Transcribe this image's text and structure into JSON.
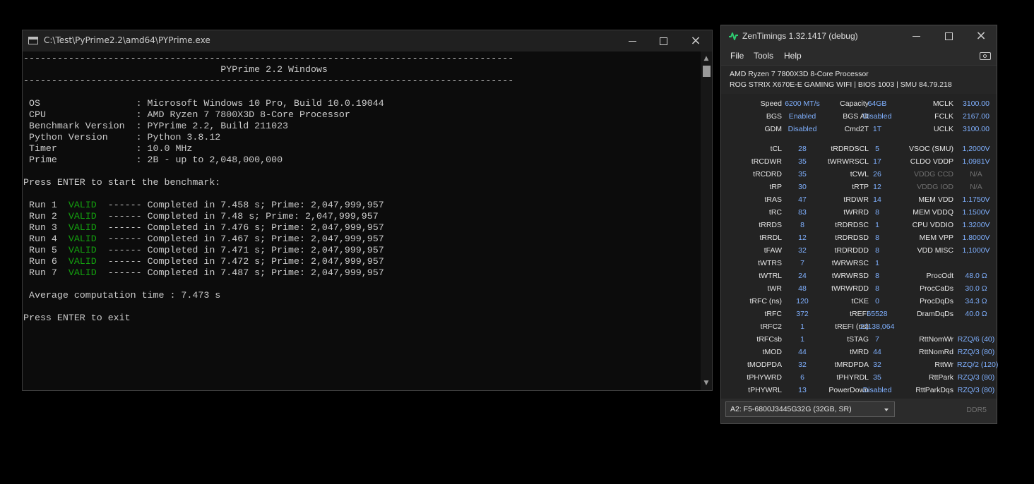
{
  "console": {
    "title": "C:\\Test\\PyPrime2.2\\amd64\\PYPrime.exe",
    "lines": [
      "---------------------------------------------------------------------------------------",
      "                                   PYPrime 2.2 Windows",
      "---------------------------------------------------------------------------------------",
      "",
      " OS                 : Microsoft Windows 10 Pro, Build 10.0.19044",
      " CPU                : AMD Ryzen 7 7800X3D 8-Core Processor",
      " Benchmark Version  : PYPrime 2.2, Build 211023",
      " Python Version     : Python 3.8.12",
      " Timer              : 10.0 MHz",
      " Prime              : 2B - up to 2,048,000,000",
      "",
      "Press ENTER to start the benchmark:",
      ""
    ],
    "runs": [
      {
        "label": " Run 1  ",
        "status": "VALID",
        "text": "  ------ Completed in 7.458 s; Prime: 2,047,999,957"
      },
      {
        "label": " Run 2  ",
        "status": "VALID",
        "text": "  ------ Completed in 7.48 s; Prime: 2,047,999,957"
      },
      {
        "label": " Run 3  ",
        "status": "VALID",
        "text": "  ------ Completed in 7.476 s; Prime: 2,047,999,957"
      },
      {
        "label": " Run 4  ",
        "status": "VALID",
        "text": "  ------ Completed in 7.467 s; Prime: 2,047,999,957"
      },
      {
        "label": " Run 5  ",
        "status": "VALID",
        "text": "  ------ Completed in 7.471 s; Prime: 2,047,999,957"
      },
      {
        "label": " Run 6  ",
        "status": "VALID",
        "text": "  ------ Completed in 7.472 s; Prime: 2,047,999,957"
      },
      {
        "label": " Run 7  ",
        "status": "VALID",
        "text": "  ------ Completed in 7.487 s; Prime: 2,047,999,957"
      }
    ],
    "tail_lines": [
      "",
      " Average computation time : 7.473 s",
      "",
      "Press ENTER to exit"
    ],
    "colors": {
      "valid": "#13a10e",
      "text": "#cccccc",
      "background": "#0c0c0c"
    }
  },
  "zen": {
    "title": "ZenTimings 1.32.1417 (debug)",
    "menu": [
      "File",
      "Tools",
      "Help"
    ],
    "cpu": "AMD Ryzen 7 7800X3D 8-Core Processor",
    "board": "ROG STRIX X670E-E GAMING WIFI | BIOS 1003 | SMU 84.79.218",
    "top_rows": [
      [
        "Speed",
        "6200 MT/s",
        "Capacity",
        "64GB",
        "MCLK",
        "3100.00"
      ],
      [
        "BGS",
        "Enabled",
        "BGS Alt",
        "Disabled",
        "FCLK",
        "2167.00"
      ],
      [
        "GDM",
        "Disabled",
        "Cmd2T",
        "1T",
        "UCLK",
        "3100.00"
      ]
    ],
    "rows": [
      [
        "tCL",
        "28",
        "tRDRDSCL",
        "5",
        "VSOC (SMU)",
        "1,2000V"
      ],
      [
        "tRCDWR",
        "35",
        "tWRWRSCL",
        "17",
        "CLDO VDDP",
        "1,0981V"
      ],
      [
        "tRCDRD",
        "35",
        "tCWL",
        "26",
        "VDDG CCD",
        "N/A"
      ],
      [
        "tRP",
        "30",
        "tRTP",
        "12",
        "VDDG IOD",
        "N/A"
      ],
      [
        "tRAS",
        "47",
        "tRDWR",
        "14",
        "MEM VDD",
        "1.1750V"
      ],
      [
        "tRC",
        "83",
        "tWRRD",
        "8",
        "MEM VDDQ",
        "1.1500V"
      ],
      [
        "tRRDS",
        "8",
        "tRDRDSC",
        "1",
        "CPU VDDIO",
        "1.3200V"
      ],
      [
        "tRRDL",
        "12",
        "tRDRDSD",
        "8",
        "MEM VPP",
        "1.8000V"
      ],
      [
        "tFAW",
        "32",
        "tRDRDDD",
        "8",
        "VDD MISC",
        "1,1000V"
      ],
      [
        "tWTRS",
        "7",
        "tWRWRSC",
        "1",
        "",
        ""
      ],
      [
        "tWTRL",
        "24",
        "tWRWRSD",
        "8",
        "ProcOdt",
        "48.0 Ω"
      ],
      [
        "tWR",
        "48",
        "tWRWRDD",
        "8",
        "ProcCaDs",
        "30.0 Ω"
      ],
      [
        "tRFC (ns)",
        "120",
        "tCKE",
        "0",
        "ProcDqDs",
        "34.3 Ω"
      ],
      [
        "tRFC",
        "372",
        "tREFI",
        "65528",
        "DramDqDs",
        "40.0 Ω"
      ],
      [
        "tRFC2",
        "1",
        "tREFI (ns)",
        "21138,064",
        "",
        ""
      ],
      [
        "tRFCsb",
        "1",
        "tSTAG",
        "7",
        "RttNomWr",
        "RZQ/6 (40)"
      ],
      [
        "tMOD",
        "44",
        "tMRD",
        "44",
        "RttNomRd",
        "RZQ/3 (80)"
      ],
      [
        "tMODPDA",
        "32",
        "tMRDPDA",
        "32",
        "RttWr",
        "RZQ/2 (120)"
      ],
      [
        "tPHYWRD",
        "6",
        "tPHYRDL",
        "35",
        "RttPark",
        "RZQ/3 (80)"
      ],
      [
        "tPHYWRL",
        "13",
        "PowerDown",
        "Disabled",
        "RttParkDqs",
        "RZQ/3 (80)"
      ]
    ],
    "dim_labels": [
      "VDDG CCD",
      "VDDG IOD"
    ],
    "module": "A2: F5-6800J3445G32G (32GB, SR)",
    "ddr": "DDR5",
    "colors": {
      "value": "#7fb0ff",
      "logo": "#2ecc71",
      "dim": "#6f6f6f"
    }
  }
}
